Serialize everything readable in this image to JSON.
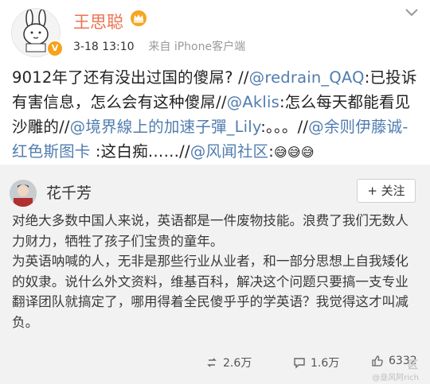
{
  "author": {
    "name": "王思聪",
    "badge_letter": "V",
    "time": "3-18 13:10",
    "source": "来自 iPhone客户端"
  },
  "post": {
    "segments": [
      {
        "text": "9012年了还有没出过国的傻屌? //",
        "type": "text"
      },
      {
        "text": "@redrain_QAQ",
        "type": "mention"
      },
      {
        "text": ":已投诉有害信息，怎么会有这种傻屌//",
        "type": "text"
      },
      {
        "text": "@Aklis",
        "type": "mention"
      },
      {
        "text": ":怎么每天都能看见沙雕的//",
        "type": "text"
      },
      {
        "text": "@境界線上的加速子彈_Lily",
        "type": "mention"
      },
      {
        "text": ":。。。//",
        "type": "text"
      },
      {
        "text": "@余则伊藤诚-红色斯图卡",
        "type": "mention"
      },
      {
        "text": " :这白痴……//",
        "type": "text"
      },
      {
        "text": "@风闻社区",
        "type": "mention"
      },
      {
        "text": ":",
        "type": "text"
      }
    ],
    "emojis": [
      "😅",
      "😅",
      "😅"
    ]
  },
  "repost": {
    "author": "花千芳",
    "follow_label": "+ 关注",
    "paragraphs": [
      "对绝大多数中国人来说，英语都是一件废物技能。浪费了我们无数人力财力，牺牲了孩子们宝贵的童年。",
      "为英语呐喊的人，无非是那些行业从业者，和一部分思想上自我矮化的奴隶。说什么外文资料，维基百科，解决这个问题只要搞一支专业翻译团队就搞定了，哪用得着全民傻乎乎的学英语？我觉得这才叫减负。"
    ],
    "stats": {
      "reposts": "2.6万",
      "comments": "1.6万",
      "likes": "6332"
    },
    "watermark": "区",
    "watermark_small": "@韭风阿rich"
  },
  "colors": {
    "name": "#eb7350",
    "mention": "#507daf",
    "repost_bg": "#f2f2f2"
  }
}
